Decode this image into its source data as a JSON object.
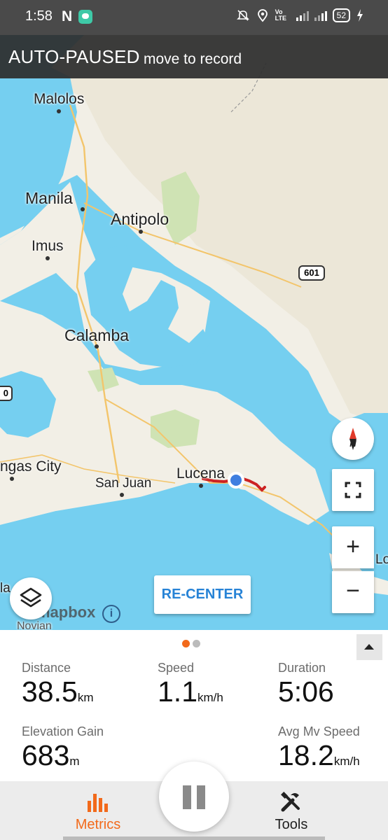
{
  "status_bar": {
    "time": "1:58",
    "n_glyph": "N",
    "network": "Vo LTE",
    "battery": "52",
    "icons": [
      "n-notification-icon",
      "message-icon",
      "mute-icon",
      "location-icon",
      "volte-icon",
      "signal-icon",
      "battery-icon",
      "charging-icon"
    ]
  },
  "banner": {
    "state": "AUTO-PAUSED",
    "hint": "move to record"
  },
  "map": {
    "places": {
      "malolos": "Malolos",
      "manila": "Manila",
      "antipolo": "Antipolo",
      "imus": "Imus",
      "calamba": "Calamba",
      "batangas": "ngas City",
      "san_juan": "San Juan",
      "lucena": "Lucena",
      "lo": "Lo",
      "la": "la",
      "novian": "Novian"
    },
    "route_shield": "601",
    "edge_shield": "0",
    "attribution": "mapbox",
    "recenter_label": "RE-CENTER",
    "compass_label": "N",
    "zoom_in": "+",
    "zoom_out": "−",
    "colors": {
      "water": "#75cff0",
      "land": "#f2efe6",
      "park": "#cfe3b4",
      "route": "#cc2222",
      "location": "#3f7fe0"
    }
  },
  "pager": {
    "active_color": "#f26a1b",
    "inactive_color": "#bbbbbb"
  },
  "metrics": {
    "distance": {
      "label": "Distance",
      "value": "38.5",
      "unit": "km"
    },
    "speed": {
      "label": "Speed",
      "value": "1.1",
      "unit": "km/h"
    },
    "duration": {
      "label": "Duration",
      "value": "5:06",
      "unit": ""
    },
    "elevation_gain": {
      "label": "Elevation Gain",
      "value": "683",
      "unit": "m"
    },
    "avg_mv_speed": {
      "label": "Avg Mv Speed",
      "value": "18.2",
      "unit": "km/h"
    }
  },
  "nav": {
    "metrics_label": "Metrics",
    "tools_label": "Tools",
    "accent": "#f26a1b"
  }
}
